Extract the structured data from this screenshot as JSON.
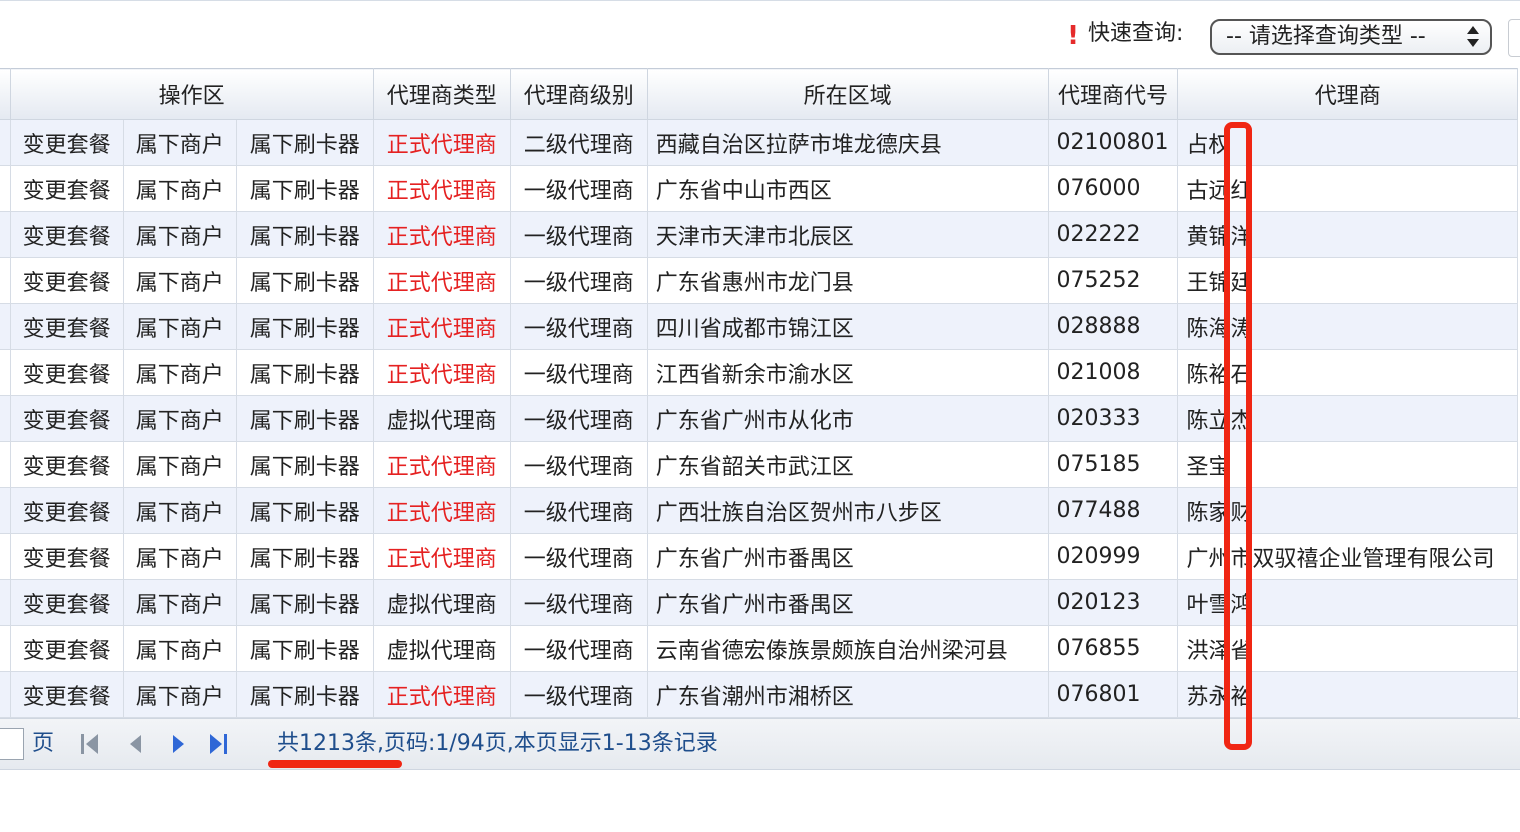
{
  "toolbar": {
    "required_mark": "!",
    "quick_query_label": "快速查询:",
    "query_type_placeholder": "-- 请选择查询类型 --"
  },
  "table": {
    "headers": {
      "ops": "操作区",
      "agent_type": "代理商类型",
      "agent_level": "代理商级别",
      "region": "所在区域",
      "agent_code": "代理商代号",
      "agent_name": "代理商"
    },
    "rows": [
      {
        "change_plan": "变更套餐",
        "merchants": "属下商户",
        "readers": "属下刷卡器",
        "type": "正式代理商",
        "type_official": true,
        "level": "二级代理商",
        "region": "西藏自治区拉萨市堆龙德庆县",
        "code": "02100801",
        "name": "占权"
      },
      {
        "change_plan": "变更套餐",
        "merchants": "属下商户",
        "readers": "属下刷卡器",
        "type": "正式代理商",
        "type_official": true,
        "level": "一级代理商",
        "region": "广东省中山市西区",
        "code": "076000",
        "name": "古远红"
      },
      {
        "change_plan": "变更套餐",
        "merchants": "属下商户",
        "readers": "属下刷卡器",
        "type": "正式代理商",
        "type_official": true,
        "level": "一级代理商",
        "region": "天津市天津市北辰区",
        "code": "022222",
        "name": "黄锦洋"
      },
      {
        "change_plan": "变更套餐",
        "merchants": "属下商户",
        "readers": "属下刷卡器",
        "type": "正式代理商",
        "type_official": true,
        "level": "一级代理商",
        "region": "广东省惠州市龙门县",
        "code": "075252",
        "name": "王锦廷"
      },
      {
        "change_plan": "变更套餐",
        "merchants": "属下商户",
        "readers": "属下刷卡器",
        "type": "正式代理商",
        "type_official": true,
        "level": "一级代理商",
        "region": "四川省成都市锦江区",
        "code": "028888",
        "name": "陈海涛"
      },
      {
        "change_plan": "变更套餐",
        "merchants": "属下商户",
        "readers": "属下刷卡器",
        "type": "正式代理商",
        "type_official": true,
        "level": "一级代理商",
        "region": "江西省新余市渝水区",
        "code": "021008",
        "name": "陈裕石"
      },
      {
        "change_plan": "变更套餐",
        "merchants": "属下商户",
        "readers": "属下刷卡器",
        "type": "虚拟代理商",
        "type_official": false,
        "level": "一级代理商",
        "region": "广东省广州市从化市",
        "code": "020333",
        "name": "陈立杰"
      },
      {
        "change_plan": "变更套餐",
        "merchants": "属下商户",
        "readers": "属下刷卡器",
        "type": "正式代理商",
        "type_official": true,
        "level": "一级代理商",
        "region": "广东省韶关市武江区",
        "code": "075185",
        "name": "圣宝"
      },
      {
        "change_plan": "变更套餐",
        "merchants": "属下商户",
        "readers": "属下刷卡器",
        "type": "正式代理商",
        "type_official": true,
        "level": "一级代理商",
        "region": "广西壮族自治区贺州市八步区",
        "code": "077488",
        "name": "陈家财"
      },
      {
        "change_plan": "变更套餐",
        "merchants": "属下商户",
        "readers": "属下刷卡器",
        "type": "正式代理商",
        "type_official": true,
        "level": "一级代理商",
        "region": "广东省广州市番禺区",
        "code": "020999",
        "name": "广州市双驭禧企业管理有限公司"
      },
      {
        "change_plan": "变更套餐",
        "merchants": "属下商户",
        "readers": "属下刷卡器",
        "type": "虚拟代理商",
        "type_official": false,
        "level": "一级代理商",
        "region": "广东省广州市番禺区",
        "code": "020123",
        "name": "叶雪鸿"
      },
      {
        "change_plan": "变更套餐",
        "merchants": "属下商户",
        "readers": "属下刷卡器",
        "type": "虚拟代理商",
        "type_official": false,
        "level": "一级代理商",
        "region": "云南省德宏傣族景颇族自治州梁河县",
        "code": "076855",
        "name": "洪泽省"
      },
      {
        "change_plan": "变更套餐",
        "merchants": "属下商户",
        "readers": "属下刷卡器",
        "type": "正式代理商",
        "type_official": true,
        "level": "一级代理商",
        "region": "广东省潮州市湘桥区",
        "code": "076801",
        "name": "苏永裕"
      }
    ]
  },
  "pager": {
    "page_word": "页",
    "info": "共1213条,页码:1/94页,本页显示1-13条记录"
  },
  "colors": {
    "official_type": "#e52121",
    "pager_text": "#1f4e8c",
    "annotation": "#f02613",
    "row_alt": "#eef2fb"
  },
  "icons": {
    "first": "first-page-icon",
    "prev": "prev-page-icon",
    "next": "next-page-icon",
    "last": "last-page-icon",
    "select_arrows": "updown-arrows-icon"
  }
}
